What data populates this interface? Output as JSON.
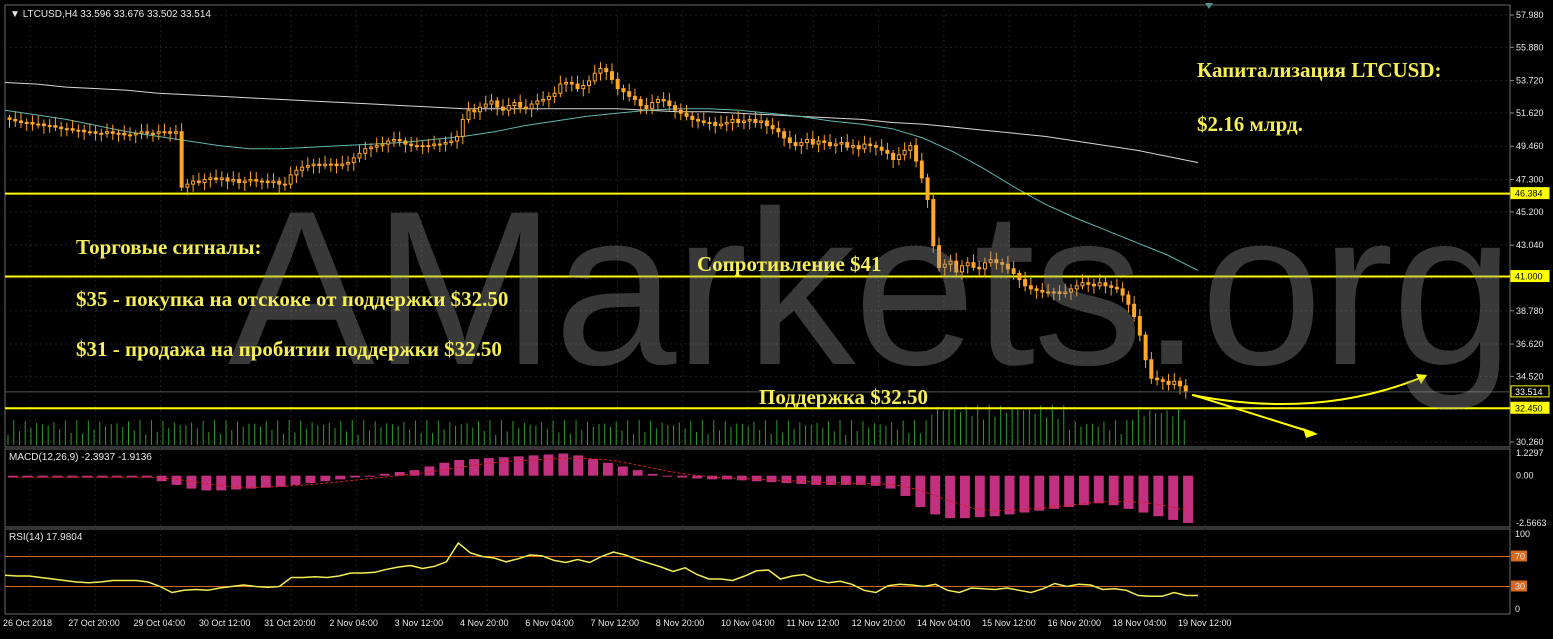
{
  "colors": {
    "background": "#000000",
    "grid": "#1f1f1f",
    "axis_text": "#e8e8e8",
    "candle": "#ffa726",
    "annotation": "#f5ee55",
    "ma_fast": "#5fb8b0",
    "ma_slow": "#d8d8d8",
    "volume": "#2e9b2e",
    "macd_hist": "#c2307f",
    "macd_signal": "#d02020",
    "rsi_line": "#f5ee55",
    "rsi_levels": "#d2691e",
    "level_line": "#ffff00"
  },
  "header": {
    "symbol_line": "LTCUSD,H4  33.596 33.676 33.502 33.514",
    "macd_label": "MACD(12,26,9) -2.3937 -1.9136",
    "rsi_label": "RSI(14) 17.9804"
  },
  "annotations": {
    "cap_title": "Капитализация LTCUSD:",
    "cap_value": "$2.16 млрд.",
    "signals_title": "Торговые сигналы:",
    "signal_buy": "$35 - покупка на отскоке от поддержки $32.50",
    "signal_sell": "$31 - продажа на пробитии поддержки  $32.50",
    "resistance": "Сопротивление $41",
    "support": "Поддержка $32.50",
    "watermark": "AMarkets.org"
  },
  "price_axis": {
    "ticks": [
      "57.980",
      "55.880",
      "53.720",
      "51.620",
      "49.460",
      "47.300",
      "45.200",
      "43.040",
      "40.880",
      "38.780",
      "36.620",
      "34.520",
      "32.360",
      "30.260"
    ],
    "tags": [
      {
        "label": "46.384",
        "value": 46.384
      },
      {
        "label": "41.000",
        "value": 41.0
      },
      {
        "label": "33.514",
        "value": 33.514
      },
      {
        "label": "32.450",
        "value": 32.45
      }
    ]
  },
  "macd_axis": {
    "ticks": [
      "1.2297",
      "0.00",
      "-2.5663"
    ]
  },
  "rsi_axis": {
    "ticks": [
      "100",
      "70",
      "30",
      "0"
    ],
    "levels": [
      "70",
      "30"
    ]
  },
  "time_axis": [
    "26 Oct 2018",
    "27 Oct 20:00",
    "29 Oct 04:00",
    "30 Oct 12:00",
    "31 Oct 20:00",
    "2 Nov 04:00",
    "3 Nov 12:00",
    "4 Nov 20:00",
    "6 Nov 04:00",
    "7 Nov 12:00",
    "8 Nov 20:00",
    "10 Nov 04:00",
    "11 Nov 12:00",
    "12 Nov 20:00",
    "14 Nov 04:00",
    "15 Nov 12:00",
    "16 Nov 20:00",
    "18 Nov 04:00",
    "19 Nov 12:00"
  ],
  "chart_data": {
    "type": "candlestick",
    "symbol": "LTCUSD",
    "timeframe": "H4",
    "ylim": [
      30.26,
      57.98
    ],
    "horizontal_levels": [
      46.384,
      41.0,
      32.45
    ],
    "close": [
      51.2,
      51.1,
      51.0,
      51.0,
      50.9,
      50.9,
      50.8,
      50.8,
      50.7,
      50.6,
      50.6,
      50.5,
      50.5,
      50.4,
      50.4,
      50.3,
      50.3,
      50.4,
      50.3,
      50.3,
      50.2,
      50.2,
      50.3,
      50.4,
      50.3,
      50.3,
      50.4,
      50.4,
      50.3,
      50.4,
      46.8,
      47.0,
      47.2,
      47.1,
      47.3,
      47.4,
      47.3,
      47.4,
      47.2,
      47.3,
      47.1,
      47.2,
      47.3,
      47.2,
      47.2,
      47.1,
      47.2,
      47.0,
      47.0,
      47.6,
      47.9,
      48.1,
      48.2,
      48.3,
      48.2,
      48.3,
      48.3,
      48.2,
      48.3,
      48.4,
      48.7,
      49.0,
      49.3,
      49.4,
      49.5,
      49.6,
      49.8,
      49.9,
      49.8,
      49.6,
      49.5,
      49.5,
      49.5,
      49.5,
      49.6,
      49.6,
      49.7,
      49.8,
      50.1,
      51.2,
      51.8,
      51.7,
      52.0,
      52.2,
      52.4,
      52.0,
      51.8,
      52.1,
      52.3,
      52.0,
      51.9,
      52.2,
      52.4,
      52.5,
      52.7,
      52.9,
      53.5,
      53.6,
      53.5,
      53.2,
      53.4,
      53.7,
      54.2,
      54.5,
      54.3,
      53.8,
      53.2,
      53.0,
      52.7,
      52.5,
      52.1,
      51.9,
      52.3,
      52.5,
      52.4,
      52.1,
      51.8,
      51.6,
      51.4,
      51.2,
      51.1,
      51.0,
      51.0,
      50.8,
      50.9,
      51.0,
      51.2,
      51.0,
      51.1,
      51.2,
      51.0,
      51.1,
      50.8,
      50.6,
      50.4,
      50.0,
      49.7,
      49.5,
      49.7,
      49.9,
      49.6,
      49.8,
      49.7,
      49.5,
      49.6,
      49.7,
      49.4,
      49.5,
      49.3,
      49.6,
      49.5,
      49.4,
      49.2,
      49.0,
      48.6,
      48.9,
      49.2,
      49.5,
      48.5,
      47.4,
      46.0,
      43.0,
      41.6,
      41.8,
      42.0,
      41.3,
      41.7,
      41.9,
      41.6,
      41.5,
      41.9,
      42.1,
      41.9,
      41.8,
      41.5,
      41.2,
      40.8,
      40.4,
      40.2,
      40.1,
      40.0,
      40.0,
      40.0,
      39.9,
      40.0,
      40.2,
      40.4,
      40.6,
      40.5,
      40.4,
      40.6,
      40.4,
      40.3,
      40.2,
      39.8,
      39.2,
      38.4,
      37.2,
      35.6,
      34.4,
      34.3,
      34.2,
      34.0,
      34.2,
      33.9,
      33.514
    ],
    "ma_fast": [
      51.8,
      51.5,
      51.2,
      50.8,
      50.4,
      50.1,
      49.8,
      49.5,
      49.3,
      49.3,
      49.4,
      49.5,
      49.6,
      49.7,
      49.9,
      50.1,
      50.4,
      50.8,
      51.1,
      51.4,
      51.6,
      51.8,
      51.9,
      51.9,
      51.8,
      51.6,
      51.4,
      51.1,
      50.9,
      50.6,
      50.0,
      49.1,
      48.0,
      46.8,
      45.7,
      44.8,
      44.0,
      43.2,
      42.4,
      41.4
    ],
    "ma_slow": [
      53.6,
      53.5,
      53.3,
      53.2,
      53.1,
      52.9,
      52.8,
      52.7,
      52.6,
      52.5,
      52.4,
      52.3,
      52.2,
      52.1,
      52.0,
      51.9,
      51.9,
      51.9,
      51.9,
      51.9,
      51.9,
      51.8,
      51.7,
      51.7,
      51.6,
      51.5,
      51.4,
      51.3,
      51.2,
      51.0,
      50.9,
      50.7,
      50.5,
      50.3,
      50.1,
      49.8,
      49.5,
      49.2,
      48.8,
      48.4
    ],
    "macd_range": [
      -2.5663,
      1.2297
    ],
    "macd_hist": [
      -0.1,
      -0.1,
      -0.1,
      -0.1,
      -0.1,
      -0.1,
      -0.1,
      -0.1,
      -0.1,
      -0.1,
      -0.3,
      -0.5,
      -0.7,
      -0.8,
      -0.8,
      -0.75,
      -0.7,
      -0.65,
      -0.6,
      -0.5,
      -0.4,
      -0.3,
      -0.2,
      -0.1,
      0.0,
      0.1,
      0.2,
      0.3,
      0.5,
      0.7,
      0.85,
      0.9,
      0.95,
      1.0,
      1.05,
      1.1,
      1.15,
      1.2,
      1.1,
      0.9,
      0.7,
      0.5,
      0.3,
      0.1,
      0.0,
      -0.1,
      -0.15,
      -0.2,
      -0.2,
      -0.25,
      -0.3,
      -0.35,
      -0.4,
      -0.45,
      -0.5,
      -0.5,
      -0.5,
      -0.5,
      -0.55,
      -0.7,
      -1.1,
      -1.7,
      -2.1,
      -2.3,
      -2.3,
      -2.25,
      -2.2,
      -2.1,
      -2.0,
      -1.9,
      -1.8,
      -1.7,
      -1.6,
      -1.5,
      -1.6,
      -1.8,
      -2.0,
      -2.2,
      -2.4,
      -2.5663
    ],
    "rsi": [
      45,
      44,
      44,
      42,
      40,
      38,
      36,
      35,
      36,
      38,
      38,
      38,
      36,
      30,
      22,
      25,
      26,
      25,
      28,
      30,
      32,
      30,
      29,
      30,
      42,
      42,
      43,
      42,
      44,
      48,
      48,
      49,
      53,
      56,
      58,
      54,
      57,
      63,
      88,
      75,
      70,
      68,
      63,
      67,
      72,
      71,
      65,
      62,
      66,
      62,
      70,
      76,
      72,
      66,
      61,
      56,
      50,
      55,
      46,
      40,
      40,
      38,
      44,
      51,
      52,
      40,
      44,
      46,
      39,
      35,
      37,
      33,
      25,
      22,
      31,
      33,
      32,
      30,
      33,
      25,
      22,
      28,
      27,
      26,
      28,
      25,
      22,
      27,
      34,
      30,
      33,
      32,
      26,
      27,
      25,
      18,
      17,
      17,
      22,
      18,
      18
    ]
  }
}
